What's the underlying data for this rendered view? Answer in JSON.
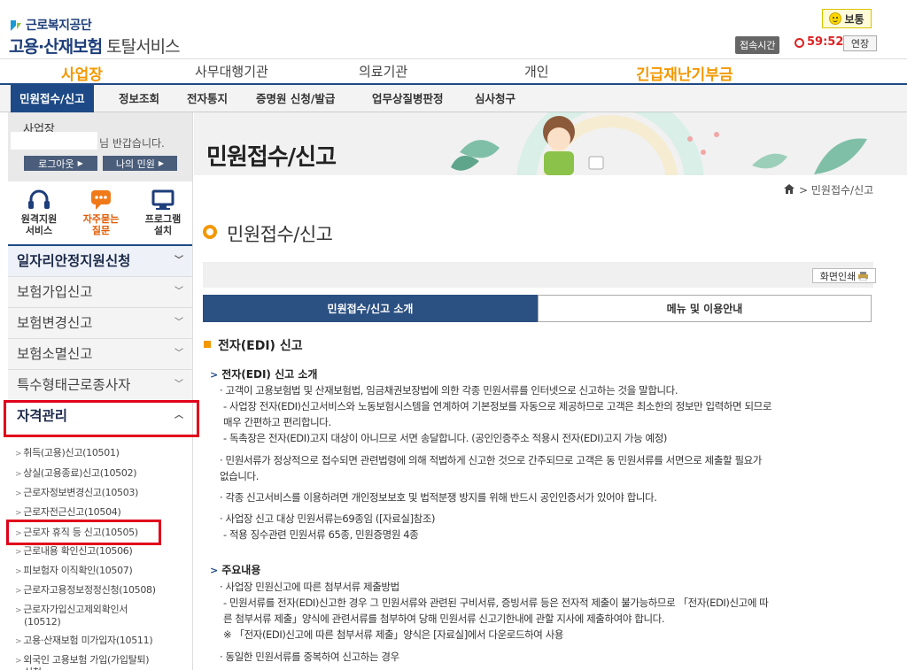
{
  "brand": {
    "org": "근로복지공단",
    "title_bold": "고용·산재보험",
    "title_thin": " 토탈서비스"
  },
  "status": {
    "mood": "보통",
    "session_label": "접속시간",
    "session_time": "59:52",
    "extend": "연장"
  },
  "gnb": [
    "사업장",
    "사무대행기관",
    "의료기관",
    "개인",
    "긴급재난기부금"
  ],
  "subnav": [
    "민원접수/신고",
    "정보조회",
    "전자통지",
    "증명원 신청/발급",
    "업무상질병판정",
    "심사청구"
  ],
  "user": {
    "type": "사업장",
    "greet": "님 반갑습니다.",
    "logout": "로그아웃",
    "myinfo": "나의 민원"
  },
  "quick": [
    {
      "line1": "원격지원",
      "line2": "서비스",
      "icon": "headset-icon"
    },
    {
      "line1": "자주묻는",
      "line2": "질문",
      "icon": "faq-chat-icon"
    },
    {
      "line1": "프로그램",
      "line2": "설치",
      "icon": "monitor-icon"
    }
  ],
  "lnb": [
    "일자리안정지원신청",
    "보험가입신고",
    "보험변경신고",
    "보험소멸신고",
    "특수형태근로종사자",
    "자격관리"
  ],
  "lnb_sub": [
    "취득(고용)신고(10501)",
    "상실(고용종료)신고(10502)",
    "근로자정보변경신고(10503)",
    "근로자전근신고(10504)",
    "근로자 휴직 등 신고(10505)",
    "근로내용 확인신고(10506)",
    "피보험자 이직확인(10507)",
    "근로자고용정보정정신청(10508)",
    "근로자가입신고제외확인서",
    "(10512)",
    "고용·산재보험 미가입자(10511)",
    "외국인 고용보험 가입(가입탈퇴)",
    "신청"
  ],
  "banner": {
    "title": "민원접수/신고"
  },
  "breadcrumb": "민원접수/신고",
  "page_title": "민원접수/신고",
  "print": "화면인쇄",
  "tabs": [
    "민원접수/신고 소개",
    "메뉴 및 이용안내"
  ],
  "section": {
    "title": "전자(EDI) 신고",
    "sub1": "전자(EDI) 신고 소개",
    "lines1": [
      "· 고객이 고용보험법 및 산재보험법, 임금채권보장법에 의한 각종 민원서류를 인터넷으로 신고하는 것을 말합니다.",
      "  - 사업장 전자(EDI)신고서비스와 노동보험시스템을 연계하여 기본정보를 자동으로 제공하므로 고객은 최소한의 정보만 입력하면 되므로",
      "    매우 간편하고 편리합니다.",
      "  - 독촉장은 전자(EDI)고지 대상이 아니므로 서면 송달합니다. (공인인증주소 적용시 전자(EDI)고지 가능 예정)",
      "· 민원서류가 정상적으로 접수되면 관련법령에 의해 적법하게 신고한 것으로 간주되므로 고객은 동 민원서류를 서면으로 제출할 필요가",
      "  없습니다.",
      "· 각종 신고서비스를 이용하려면 개인정보보호 및 법적분쟁 방지를 위해 반드시 공인인증서가 있어야 합니다.",
      "· 사업장 신고 대상 민원서류는69종임 ([자료실]참조)",
      "  - 적용 징수관련 민원서류 65종, 민원증명원 4종"
    ],
    "sub2": "주요내용",
    "lines2": [
      "· 사업장 민원신고에 따른 첨부서류 제출방법",
      "  - 민원서류를 전자(EDI)신고한 경우 그 민원서류와 관련된 구비서류, 증빙서류 등은 전자적 제출이 불가능하므로 「전자(EDI)신고에 따",
      "    른 첨부서류 제출」양식에 관련서류를 첨부하여 당해 민원서류 신고기한내에 관할 지사에 제출하여야 합니다.",
      "  ※ 「전자(EDI)신고에 따른 첨부서류 제출」양식은 [자료실]에서 다운로드하여 사용",
      "· 동일한 민원서류를 중복하여 신고하는 경우"
    ]
  }
}
